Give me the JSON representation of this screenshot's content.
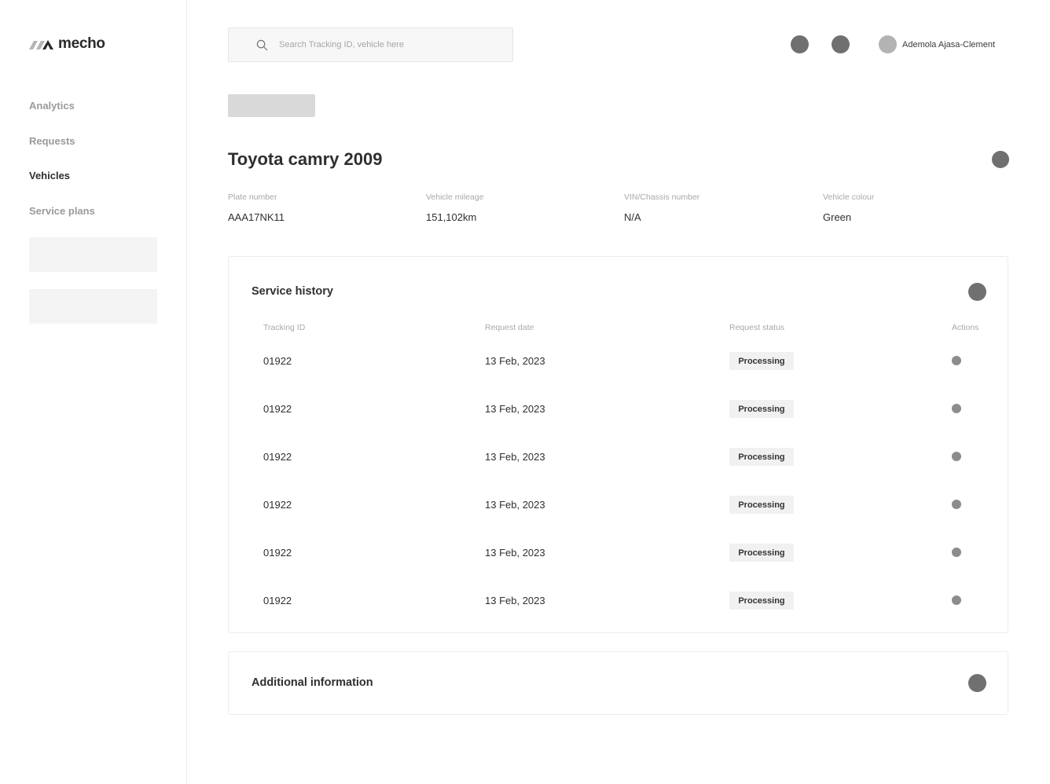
{
  "brand": {
    "name": "mecho"
  },
  "sidebar": {
    "items": [
      {
        "label": "Analytics",
        "active": false
      },
      {
        "label": "Requests",
        "active": false
      },
      {
        "label": "Vehicles",
        "active": true
      },
      {
        "label": "Service plans",
        "active": false
      }
    ]
  },
  "header": {
    "search_placeholder": "Search Tracking ID, vehicle here",
    "user_name": "Ademola Ajasa-Clement"
  },
  "vehicle": {
    "title": "Toyota camry 2009",
    "fields": [
      {
        "label": "Plate number",
        "value": "AAA17NK11"
      },
      {
        "label": "Vehicle mileage",
        "value": "151,102km"
      },
      {
        "label": "VIN/Chassis number",
        "value": "N/A"
      },
      {
        "label": "Vehicle colour",
        "value": "Green"
      }
    ]
  },
  "service_history": {
    "title": "Service history",
    "columns": [
      "Tracking ID",
      "Request date",
      "Request status",
      "Actions"
    ],
    "rows": [
      {
        "tracking_id": "01922",
        "date": "13 Feb, 2023",
        "status": "Processing"
      },
      {
        "tracking_id": "01922",
        "date": "13 Feb, 2023",
        "status": "Processing"
      },
      {
        "tracking_id": "01922",
        "date": "13 Feb, 2023",
        "status": "Processing"
      },
      {
        "tracking_id": "01922",
        "date": "13 Feb, 2023",
        "status": "Processing"
      },
      {
        "tracking_id": "01922",
        "date": "13 Feb, 2023",
        "status": "Processing"
      },
      {
        "tracking_id": "01922",
        "date": "13 Feb, 2023",
        "status": "Processing"
      }
    ]
  },
  "additional_info": {
    "title": "Additional information"
  },
  "colors": {
    "icon_gray": "#707070",
    "badge_bg": "#f1f1f1",
    "placeholder": "#f4f4f4"
  }
}
